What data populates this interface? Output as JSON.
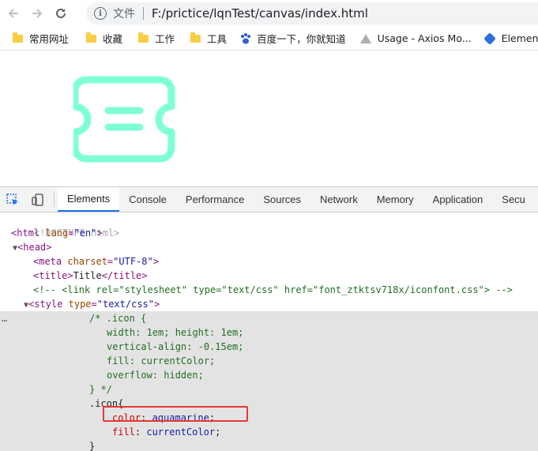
{
  "browser": {
    "scheme_label": "文件",
    "url": "F:/prictice/lqnTest/canvas/index.html",
    "bookmarks": [
      "常用网址",
      "收藏",
      "工作",
      "工具",
      "百度一下，你就知道",
      "Usage - Axios Mo...",
      "Element - l"
    ]
  },
  "page": {
    "icon_color": "#7fffd4"
  },
  "devtools": {
    "tabs": [
      "Elements",
      "Console",
      "Performance",
      "Sources",
      "Network",
      "Memory",
      "Application",
      "Secu"
    ],
    "active_tab": "Elements",
    "lines": {
      "l1": "<!DOCTYPE html>",
      "l2_tag": "<html",
      "l2_attr": " lang",
      "l2_val": "\"en\"",
      "l2_end": ">",
      "l3": "<head>",
      "l4_tag": "<meta",
      "l4_attr": " charset",
      "l4_val": "\"UTF-8\"",
      "l4_end": ">",
      "l5_open": "<title>",
      "l5_text": "Title",
      "l5_close": "</title>",
      "l6": "<!-- <link rel=\"stylesheet\" type=\"text/css\" href=\"font_ztktsv718x/iconfont.css\"> -->",
      "l7_tag": "<style",
      "l7_attr": " type",
      "l7_val": "\"text/css\"",
      "l7_end": ">",
      "l8": "/* .icon {",
      "l9": "width: 1em; height: 1em;",
      "l10": "vertical-align: -0.15em;",
      "l11": "fill: currentColor;",
      "l12": "overflow: hidden;",
      "l13": "} */",
      "l14": ".icon{",
      "l15_prop": "color",
      "l15_val": "aquamarine",
      "l16_prop": "fill",
      "l16_val": "currentColor",
      "l17": "}"
    }
  }
}
